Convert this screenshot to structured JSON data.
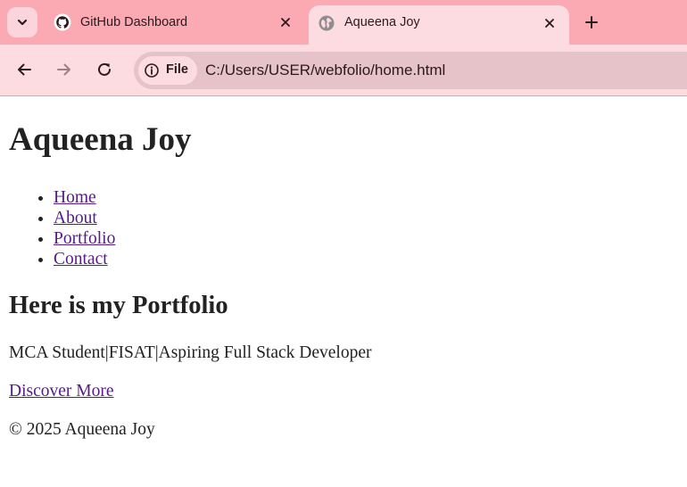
{
  "browser": {
    "tabs": [
      {
        "title": "GitHub Dashboard",
        "active": false,
        "favicon": "github-icon"
      },
      {
        "title": "Aqueena Joy",
        "active": true,
        "favicon": "globe-icon"
      }
    ],
    "address_bar": {
      "chip_label": "File",
      "url": "C:/Users/USER/webfolio/home.html"
    },
    "colors": {
      "tabstrip": "#fbaab4",
      "toolbar": "#fddce1",
      "omnibox": "#e5c3c8"
    }
  },
  "page": {
    "heading": "Aqueena Joy",
    "nav": [
      {
        "label": "Home"
      },
      {
        "label": "About"
      },
      {
        "label": "Portfolio"
      },
      {
        "label": "Contact"
      }
    ],
    "section_heading": "Here is my Portfolio",
    "tagline": "MCA Student|FISAT|Aspiring Full Stack Developer",
    "cta_link": "Discover More",
    "footer": "© 2025 Aqueena Joy",
    "colors": {
      "link": "#551a8b",
      "text": "#222222"
    }
  }
}
